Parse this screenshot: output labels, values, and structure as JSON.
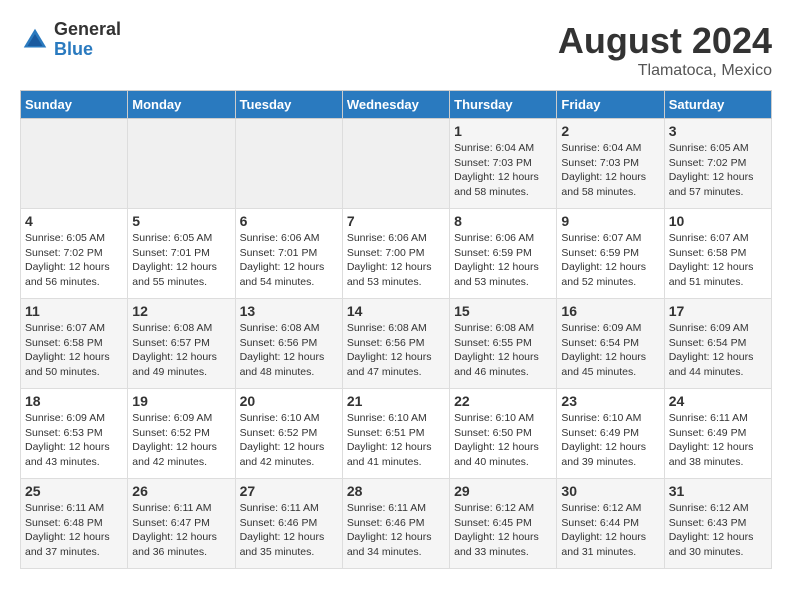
{
  "header": {
    "logo_general": "General",
    "logo_blue": "Blue",
    "month_year": "August 2024",
    "location": "Tlamatoca, Mexico"
  },
  "days_of_week": [
    "Sunday",
    "Monday",
    "Tuesday",
    "Wednesday",
    "Thursday",
    "Friday",
    "Saturday"
  ],
  "weeks": [
    [
      {
        "day": "",
        "info": ""
      },
      {
        "day": "",
        "info": ""
      },
      {
        "day": "",
        "info": ""
      },
      {
        "day": "",
        "info": ""
      },
      {
        "day": "1",
        "info": "Sunrise: 6:04 AM\nSunset: 7:03 PM\nDaylight: 12 hours\nand 58 minutes."
      },
      {
        "day": "2",
        "info": "Sunrise: 6:04 AM\nSunset: 7:03 PM\nDaylight: 12 hours\nand 58 minutes."
      },
      {
        "day": "3",
        "info": "Sunrise: 6:05 AM\nSunset: 7:02 PM\nDaylight: 12 hours\nand 57 minutes."
      }
    ],
    [
      {
        "day": "4",
        "info": "Sunrise: 6:05 AM\nSunset: 7:02 PM\nDaylight: 12 hours\nand 56 minutes."
      },
      {
        "day": "5",
        "info": "Sunrise: 6:05 AM\nSunset: 7:01 PM\nDaylight: 12 hours\nand 55 minutes."
      },
      {
        "day": "6",
        "info": "Sunrise: 6:06 AM\nSunset: 7:01 PM\nDaylight: 12 hours\nand 54 minutes."
      },
      {
        "day": "7",
        "info": "Sunrise: 6:06 AM\nSunset: 7:00 PM\nDaylight: 12 hours\nand 53 minutes."
      },
      {
        "day": "8",
        "info": "Sunrise: 6:06 AM\nSunset: 6:59 PM\nDaylight: 12 hours\nand 53 minutes."
      },
      {
        "day": "9",
        "info": "Sunrise: 6:07 AM\nSunset: 6:59 PM\nDaylight: 12 hours\nand 52 minutes."
      },
      {
        "day": "10",
        "info": "Sunrise: 6:07 AM\nSunset: 6:58 PM\nDaylight: 12 hours\nand 51 minutes."
      }
    ],
    [
      {
        "day": "11",
        "info": "Sunrise: 6:07 AM\nSunset: 6:58 PM\nDaylight: 12 hours\nand 50 minutes."
      },
      {
        "day": "12",
        "info": "Sunrise: 6:08 AM\nSunset: 6:57 PM\nDaylight: 12 hours\nand 49 minutes."
      },
      {
        "day": "13",
        "info": "Sunrise: 6:08 AM\nSunset: 6:56 PM\nDaylight: 12 hours\nand 48 minutes."
      },
      {
        "day": "14",
        "info": "Sunrise: 6:08 AM\nSunset: 6:56 PM\nDaylight: 12 hours\nand 47 minutes."
      },
      {
        "day": "15",
        "info": "Sunrise: 6:08 AM\nSunset: 6:55 PM\nDaylight: 12 hours\nand 46 minutes."
      },
      {
        "day": "16",
        "info": "Sunrise: 6:09 AM\nSunset: 6:54 PM\nDaylight: 12 hours\nand 45 minutes."
      },
      {
        "day": "17",
        "info": "Sunrise: 6:09 AM\nSunset: 6:54 PM\nDaylight: 12 hours\nand 44 minutes."
      }
    ],
    [
      {
        "day": "18",
        "info": "Sunrise: 6:09 AM\nSunset: 6:53 PM\nDaylight: 12 hours\nand 43 minutes."
      },
      {
        "day": "19",
        "info": "Sunrise: 6:09 AM\nSunset: 6:52 PM\nDaylight: 12 hours\nand 42 minutes."
      },
      {
        "day": "20",
        "info": "Sunrise: 6:10 AM\nSunset: 6:52 PM\nDaylight: 12 hours\nand 42 minutes."
      },
      {
        "day": "21",
        "info": "Sunrise: 6:10 AM\nSunset: 6:51 PM\nDaylight: 12 hours\nand 41 minutes."
      },
      {
        "day": "22",
        "info": "Sunrise: 6:10 AM\nSunset: 6:50 PM\nDaylight: 12 hours\nand 40 minutes."
      },
      {
        "day": "23",
        "info": "Sunrise: 6:10 AM\nSunset: 6:49 PM\nDaylight: 12 hours\nand 39 minutes."
      },
      {
        "day": "24",
        "info": "Sunrise: 6:11 AM\nSunset: 6:49 PM\nDaylight: 12 hours\nand 38 minutes."
      }
    ],
    [
      {
        "day": "25",
        "info": "Sunrise: 6:11 AM\nSunset: 6:48 PM\nDaylight: 12 hours\nand 37 minutes."
      },
      {
        "day": "26",
        "info": "Sunrise: 6:11 AM\nSunset: 6:47 PM\nDaylight: 12 hours\nand 36 minutes."
      },
      {
        "day": "27",
        "info": "Sunrise: 6:11 AM\nSunset: 6:46 PM\nDaylight: 12 hours\nand 35 minutes."
      },
      {
        "day": "28",
        "info": "Sunrise: 6:11 AM\nSunset: 6:46 PM\nDaylight: 12 hours\nand 34 minutes."
      },
      {
        "day": "29",
        "info": "Sunrise: 6:12 AM\nSunset: 6:45 PM\nDaylight: 12 hours\nand 33 minutes."
      },
      {
        "day": "30",
        "info": "Sunrise: 6:12 AM\nSunset: 6:44 PM\nDaylight: 12 hours\nand 31 minutes."
      },
      {
        "day": "31",
        "info": "Sunrise: 6:12 AM\nSunset: 6:43 PM\nDaylight: 12 hours\nand 30 minutes."
      }
    ]
  ]
}
